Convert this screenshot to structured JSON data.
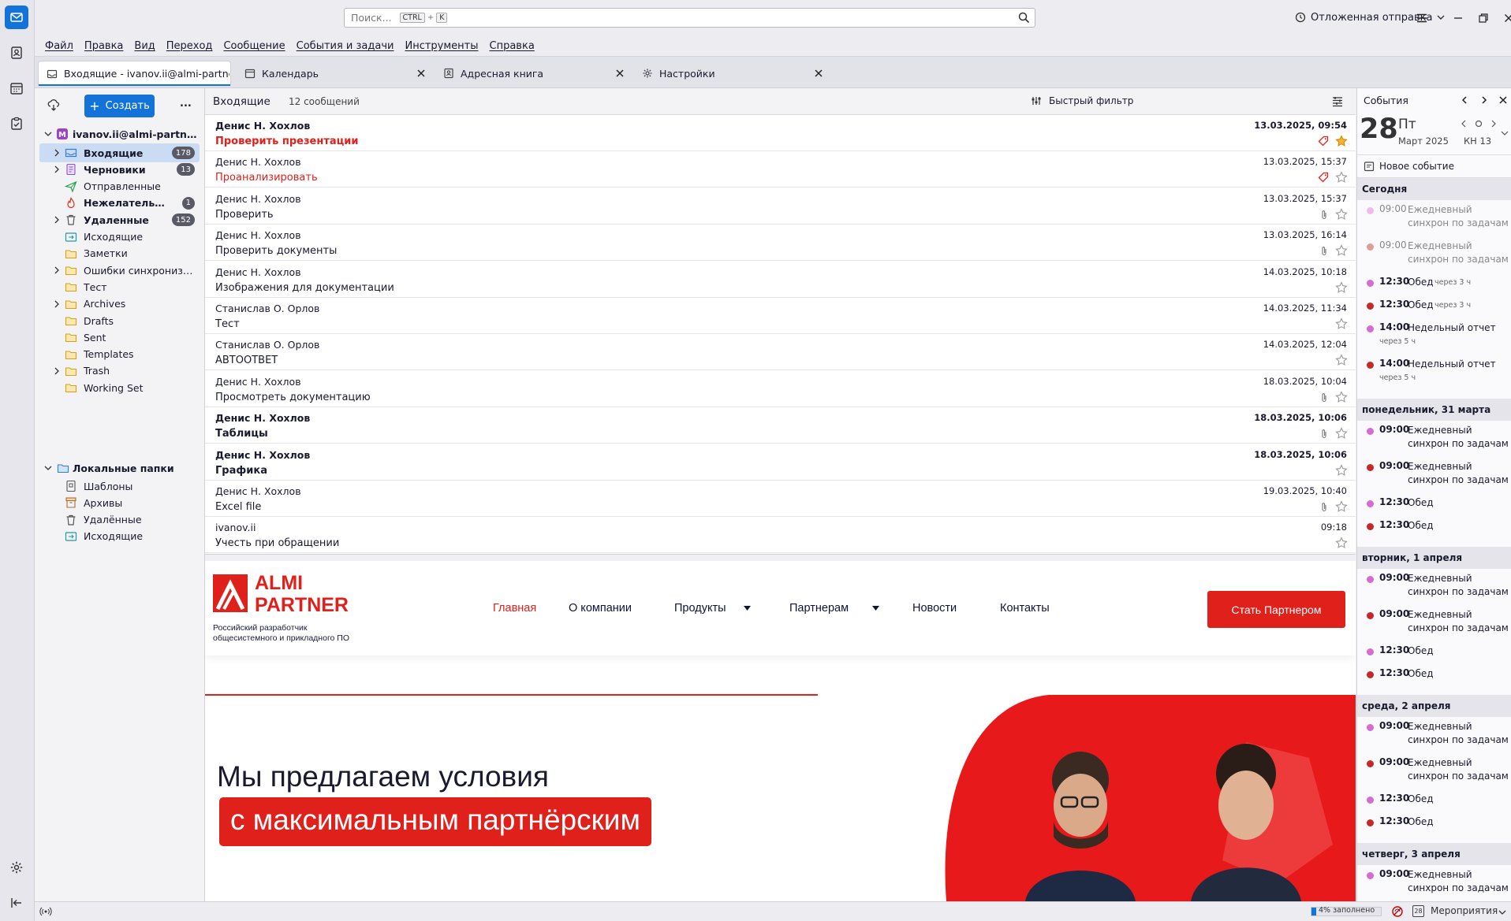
{
  "search": {
    "placeholder": "Поиск...",
    "kbd1": "CTRL",
    "plus": "+",
    "kbd2": "K"
  },
  "titlebar": {
    "delayed_send": "Отложенная отправка"
  },
  "menubar": [
    "Файл",
    "Правка",
    "Вид",
    "Переход",
    "Сообщение",
    "События и задачи",
    "Инструменты",
    "Справка"
  ],
  "tabs": [
    {
      "label": "Входящие - ivanov.ii@almi-partner.ru"
    },
    {
      "label": "Календарь"
    },
    {
      "label": "Адресная книга"
    },
    {
      "label": "Настройки"
    }
  ],
  "folderpane": {
    "create_label": "Создать",
    "more": "...",
    "account": "ivanov.ii@almi-partner.ru",
    "folders": [
      {
        "label": "Входящие",
        "count": "178"
      },
      {
        "label": "Черновики",
        "count": "13"
      },
      {
        "label": "Отправленные"
      },
      {
        "label": "Нежелательная почта",
        "count": "1"
      },
      {
        "label": "Удаленные",
        "count": "152"
      },
      {
        "label": "Исходящие"
      },
      {
        "label": "Заметки"
      },
      {
        "label": "Ошибки синхронизации"
      },
      {
        "label": "Тест"
      },
      {
        "label": "Archives"
      },
      {
        "label": "Drafts"
      },
      {
        "label": "Sent"
      },
      {
        "label": "Templates"
      },
      {
        "label": "Trash"
      },
      {
        "label": "Working Set"
      }
    ],
    "local_title": "Локальные папки",
    "local": [
      {
        "label": "Шаблоны"
      },
      {
        "label": "Архивы"
      },
      {
        "label": "Удалённые"
      },
      {
        "label": "Исходящие"
      }
    ]
  },
  "listhead": {
    "title": "Входящие",
    "count": "12 сообщений",
    "quick_filter": "Быстрый фильтр"
  },
  "messages": [
    {
      "from": "Денис Н. Хохлов",
      "subject": "Проверить презентации",
      "date": "13.03.2025, 09:54"
    },
    {
      "from": "Денис Н. Хохлов",
      "subject": "Проанализировать",
      "date": "13.03.2025, 15:37"
    },
    {
      "from": "Денис Н. Хохлов",
      "subject": "Проверить",
      "date": "13.03.2025, 15:37"
    },
    {
      "from": "Денис Н. Хохлов",
      "subject": "Проверить документы",
      "date": "13.03.2025, 16:14"
    },
    {
      "from": "Денис Н. Хохлов",
      "subject": "Изображения для документации",
      "date": "14.03.2025, 10:18"
    },
    {
      "from": "Станислав О. Орлов",
      "subject": "Тест",
      "date": "14.03.2025, 11:34"
    },
    {
      "from": "Станислав О. Орлов",
      "subject": "АВТООТВЕТ",
      "date": "14.03.2025, 12:04"
    },
    {
      "from": "Денис Н. Хохлов",
      "subject": "Просмотреть документацию",
      "date": "18.03.2025, 10:04"
    },
    {
      "from": "Денис Н. Хохлов",
      "subject": "Таблицы",
      "date": "18.03.2025, 10:06"
    },
    {
      "from": "Денис Н. Хохлов",
      "subject": "Графика",
      "date": "18.03.2025, 10:06"
    },
    {
      "from": "Денис Н. Хохлов",
      "subject": "Excel file",
      "date": "19.03.2025, 10:40"
    },
    {
      "from": "ivanov.ii",
      "subject": "Учесть при обращении",
      "date": "09:18"
    }
  ],
  "preview": {
    "logo_line1": "ALMI",
    "logo_line2": "PARTNER",
    "logo_sub1": "Российский разработчик",
    "logo_sub2": "общесистемного и прикладного ПО",
    "nav": [
      "Главная",
      "О компании",
      "Продукты",
      "Партнерам",
      "Новости",
      "Контакты"
    ],
    "cta": "Стать Партнером",
    "hero1": "Мы предлагаем условия",
    "hero2": "с максимальным партнёрским"
  },
  "today": {
    "title": "События",
    "day": "28",
    "weekday": "Пт",
    "month": "Март 2025",
    "week": "КН 13",
    "new_event": "Новое событие",
    "groups": [
      {
        "title": "Сегодня",
        "events": [
          {
            "time": "09:00",
            "title": "Ежедневный синхрон по задачам"
          },
          {
            "time": "09:00",
            "title": "Ежедневный синхрон по задачам"
          },
          {
            "time": "12:30",
            "title": "Обед",
            "rel": "через 3 ч"
          },
          {
            "time": "12:30",
            "title": "Обед",
            "rel": "через 3 ч"
          },
          {
            "time": "14:00",
            "title": "Недельный отчет",
            "rel": "через 5 ч"
          },
          {
            "time": "14:00",
            "title": "Недельный отчет",
            "rel": "через 5 ч"
          }
        ]
      },
      {
        "title": "понедельник, 31 марта",
        "events": [
          {
            "time": "09:00",
            "title": "Ежедневный синхрон по задачам"
          },
          {
            "time": "09:00",
            "title": "Ежедневный синхрон по задачам"
          },
          {
            "time": "12:30",
            "title": "Обед"
          },
          {
            "time": "12:30",
            "title": "Обед"
          }
        ]
      },
      {
        "title": "вторник, 1 апреля",
        "events": [
          {
            "time": "09:00",
            "title": "Ежедневный синхрон по задачам"
          },
          {
            "time": "09:00",
            "title": "Ежедневный синхрон по задачам"
          },
          {
            "time": "12:30",
            "title": "Обед"
          },
          {
            "time": "12:30",
            "title": "Обед"
          }
        ]
      },
      {
        "title": "среда, 2 апреля",
        "events": [
          {
            "time": "09:00",
            "title": "Ежедневный синхрон по задачам"
          },
          {
            "time": "09:00",
            "title": "Ежедневный синхрон по задачам"
          },
          {
            "time": "12:30",
            "title": "Обед"
          },
          {
            "time": "12:30",
            "title": "Обед"
          }
        ]
      },
      {
        "title": "четверг, 3 апреля",
        "events": [
          {
            "time": "09:00",
            "title": "Ежедневный синхрон по задачам"
          }
        ]
      }
    ]
  },
  "statusbar": {
    "quota": "4% заполнено",
    "events": "Мероприятия",
    "cal_day": "28"
  },
  "colors": {
    "accent": "#1373d9",
    "brand_red": "#e0201b",
    "event_pink": "#d66bd1",
    "event_red": "#c62828",
    "text": "#1a1a2e"
  }
}
